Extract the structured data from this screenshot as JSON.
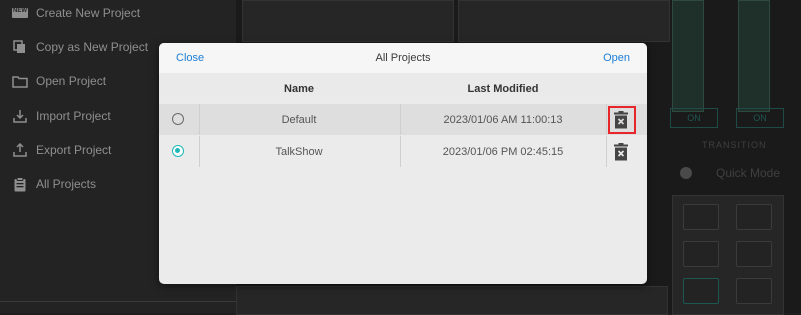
{
  "sidebar": {
    "items": [
      {
        "label": "Create New Project",
        "icon": "new-badge-icon"
      },
      {
        "label": "Copy as New Project",
        "icon": "copy-icon"
      },
      {
        "label": "Open Project",
        "icon": "folder-icon"
      },
      {
        "label": "Import Project",
        "icon": "import-icon"
      },
      {
        "label": "Export Project",
        "icon": "export-icon"
      },
      {
        "label": "All Projects",
        "icon": "clipboard-icon"
      }
    ],
    "new_badge_text": "NEW"
  },
  "background": {
    "on_label_1": "ON",
    "on_label_2": "ON",
    "transition_label": "TRANSITION",
    "quick_mode_label": "Quick Mode"
  },
  "modal": {
    "title": "All Projects",
    "close_label": "Close",
    "open_label": "Open",
    "columns": {
      "name": "Name",
      "last_modified": "Last Modified"
    },
    "rows": [
      {
        "name": "Default",
        "last_modified": "2023/01/06 AM 11:00:13",
        "selected": false,
        "highlighted": true
      },
      {
        "name": "TalkShow",
        "last_modified": "2023/01/06 PM 02:45:15",
        "selected": true,
        "highlighted": false
      }
    ]
  },
  "colors": {
    "accent_link": "#1c7fd6",
    "radio_selected": "#1db9b9",
    "highlight_box": "#e8262a"
  }
}
